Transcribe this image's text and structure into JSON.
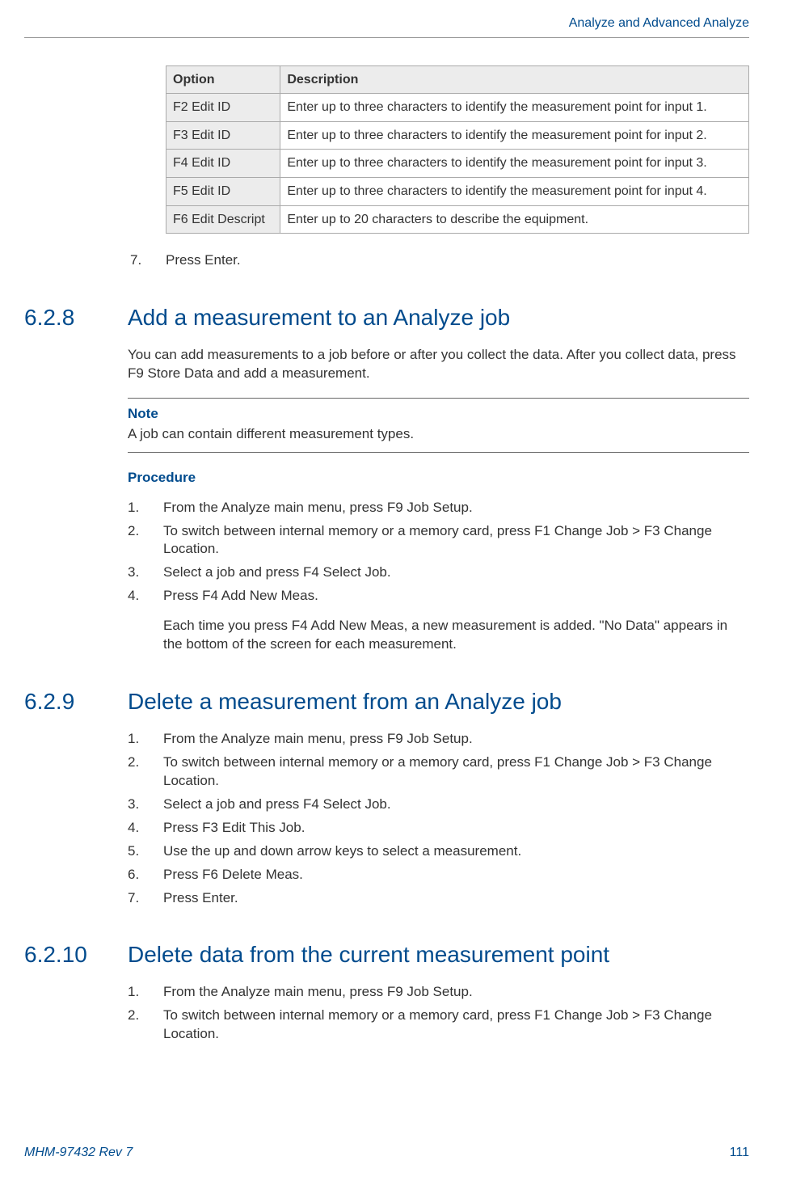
{
  "header": {
    "running_title": "Analyze and Advanced Analyze"
  },
  "table": {
    "col_option": "Option",
    "col_description": "Description",
    "rows": [
      {
        "option": "F2 Edit ID",
        "desc": "Enter up to three characters to identify the measurement point for input 1."
      },
      {
        "option": "F3 Edit ID",
        "desc": "Enter up to three characters to identify the measurement point for input 2."
      },
      {
        "option": "F4 Edit ID",
        "desc": "Enter up to three characters to identify the measurement point for input 3."
      },
      {
        "option": "F5 Edit ID",
        "desc": "Enter up to three characters to identify the measurement point for input 4."
      },
      {
        "option": "F6 Edit Descript",
        "desc": "Enter up to 20 characters to describe the equipment."
      }
    ]
  },
  "pre_step": {
    "num": "7.",
    "text": "Press Enter."
  },
  "s628": {
    "num": "6.2.8",
    "title": "Add a measurement to an Analyze job",
    "intro": "You can add measurements to a job before or after you collect the data. After you collect data, press F9 Store Data and add a measurement.",
    "note_label": "Note",
    "note_text": "A job can contain different measurement types.",
    "procedure_label": "Procedure",
    "steps": [
      {
        "n": "1.",
        "t": "From the Analyze main menu, press F9 Job Setup."
      },
      {
        "n": "2.",
        "t": "To switch between internal memory or a memory card, press F1 Change Job > F3 Change Location."
      },
      {
        "n": "3.",
        "t": "Select a job and press F4 Select Job."
      },
      {
        "n": "4.",
        "t": "Press F4 Add New Meas.",
        "after": "Each time you press F4 Add New Meas, a new measurement is added. \"No Data\" appears in the bottom of the screen for each measurement."
      }
    ]
  },
  "s629": {
    "num": "6.2.9",
    "title": "Delete a measurement from an Analyze job",
    "steps": [
      {
        "n": "1.",
        "t": "From the Analyze main menu, press F9 Job Setup."
      },
      {
        "n": "2.",
        "t": "To switch between internal memory or a memory card, press F1 Change Job > F3 Change Location."
      },
      {
        "n": "3.",
        "t": "Select a job and press F4 Select Job."
      },
      {
        "n": "4.",
        "t": "Press F3 Edit This Job."
      },
      {
        "n": "5.",
        "t": "Use the up and down arrow keys to select a measurement."
      },
      {
        "n": "6.",
        "t": "Press F6 Delete Meas."
      },
      {
        "n": "7.",
        "t": "Press Enter."
      }
    ]
  },
  "s6210": {
    "num": "6.2.10",
    "title": "Delete data from the current measurement point",
    "steps": [
      {
        "n": "1.",
        "t": "From the Analyze main menu, press F9 Job Setup."
      },
      {
        "n": "2.",
        "t": "To switch between internal memory or a memory card, press F1 Change Job > F3 Change Location."
      }
    ]
  },
  "footer": {
    "doc_id": "MHM-97432 Rev 7",
    "page": "111"
  }
}
